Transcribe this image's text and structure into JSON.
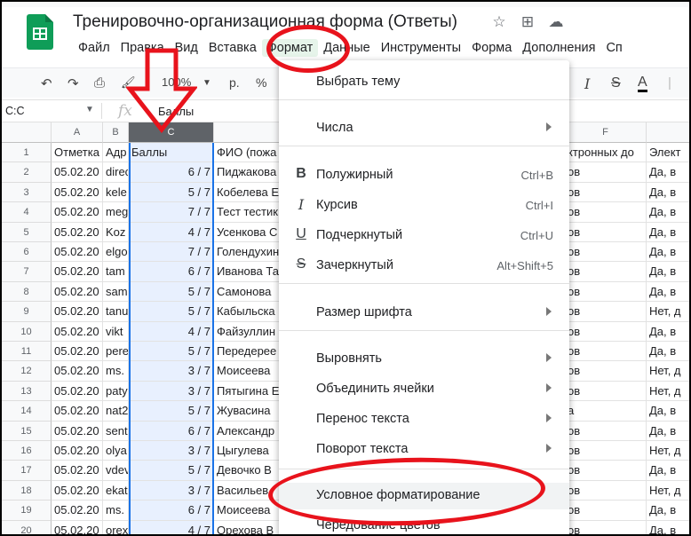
{
  "window": {
    "doc_title": "Тренировочно-организационная форма (Ответы)",
    "title_icons": [
      "star-icon",
      "move-to-folder-icon",
      "cloud-status-icon"
    ]
  },
  "menubar": {
    "items": [
      "Файл",
      "Правка",
      "Вид",
      "Вставка",
      "Формат",
      "Данные",
      "Инструменты",
      "Форма",
      "Дополнения",
      "Сп"
    ],
    "active": "Формат"
  },
  "toolbar": {
    "undo": "↶",
    "redo": "↷",
    "print": "⎙",
    "paint_format": "🖌",
    "zoom": "100%",
    "currency": "р.",
    "percent": "%",
    "italic": "I",
    "strikethrough": "S",
    "text_color": "A"
  },
  "formula_bar": {
    "name_box": "C:C",
    "fx": "fx",
    "value": "Баллы"
  },
  "columns": [
    "A",
    "B",
    "C",
    "",
    "F",
    ""
  ],
  "rows": [
    {
      "n": "1",
      "a": "Отметка",
      "b": "Адр",
      "c": "Баллы",
      "d": "ФИО (пожа",
      "f": "ктронных до",
      "g": "Элект"
    },
    {
      "n": "2",
      "a": "05.02.20",
      "b": "direc",
      "c": "6 / 7",
      "d": "Пиджакова",
      "f": "ов",
      "g": "Да, в"
    },
    {
      "n": "3",
      "a": "05.02.20",
      "b": "kele",
      "c": "5 / 7",
      "d": "Кобелева Е",
      "f": "ов",
      "g": "Да, в"
    },
    {
      "n": "4",
      "a": "05.02.20",
      "b": "meg",
      "c": "7 / 7",
      "d": "Тест тестик",
      "f": "ов",
      "g": "Да, в"
    },
    {
      "n": "5",
      "a": "05.02.20",
      "b": "Koz",
      "c": "4 / 7",
      "d": "Усенкова С",
      "f": "ов",
      "g": "Да, в"
    },
    {
      "n": "6",
      "a": "05.02.20",
      "b": "elgo",
      "c": "7 / 7",
      "d": "Голендухин",
      "f": "ов",
      "g": "Да, в"
    },
    {
      "n": "7",
      "a": "05.02.20",
      "b": "tam",
      "c": "6 / 7",
      "d": "Иванова Та",
      "f": "ов",
      "g": "Да, в"
    },
    {
      "n": "8",
      "a": "05.02.20",
      "b": "sam",
      "c": "5 / 7",
      "d": "Самонова",
      "f": "ов",
      "g": "Да, в"
    },
    {
      "n": "9",
      "a": "05.02.20",
      "b": "tanu",
      "c": "5 / 7",
      "d": "Кабыльска",
      "f": "ов",
      "g": "Нет, д"
    },
    {
      "n": "10",
      "a": "05.02.20",
      "b": "vikt",
      "c": "4 / 7",
      "d": "Файзуллин",
      "f": "ов",
      "g": "Да, в"
    },
    {
      "n": "11",
      "a": "05.02.20",
      "b": "pere",
      "c": "5 / 7",
      "d": "Передерее",
      "f": "ов",
      "g": "Да, в"
    },
    {
      "n": "12",
      "a": "05.02.20",
      "b": "ms.",
      "c": "3 / 7",
      "d": "Моисеева",
      "f": "ов",
      "g": "Нет, д"
    },
    {
      "n": "13",
      "a": "05.02.20",
      "b": "paty",
      "c": "3 / 7",
      "d": "Пятыгина Е",
      "f": "ов",
      "g": "Нет, д"
    },
    {
      "n": "14",
      "a": "05.02.20",
      "b": "nat2",
      "c": "5 / 7",
      "d": "Жувасина",
      "f": "а",
      "g": "Да, в"
    },
    {
      "n": "15",
      "a": "05.02.20",
      "b": "sent",
      "c": "6 / 7",
      "d": "Александр",
      "f": "ов",
      "g": "Да, в"
    },
    {
      "n": "16",
      "a": "05.02.20",
      "b": "olya",
      "c": "3 / 7",
      "d": "Цыгулева",
      "f": "ов",
      "g": "Нет, д"
    },
    {
      "n": "17",
      "a": "05.02.20",
      "b": "vdev",
      "c": "5 / 7",
      "d": "Девочко В",
      "f": "ов",
      "g": "Да, в"
    },
    {
      "n": "18",
      "a": "05.02.20",
      "b": "ekat",
      "c": "3 / 7",
      "d": "Васильев",
      "f": "ов",
      "g": "Нет, д"
    },
    {
      "n": "19",
      "a": "05.02.20",
      "b": "ms.",
      "c": "6 / 7",
      "d": "Моисеева",
      "f": "ов",
      "g": "Да, в"
    },
    {
      "n": "20",
      "a": "05.02.20",
      "b": "orex",
      "c": "4 / 7",
      "d": "Орехова В",
      "f": "ов",
      "g": "Да, в"
    }
  ],
  "format_menu": {
    "items": [
      {
        "label": "Выбрать тему",
        "icon": "",
        "shortcut": "",
        "submenu": false
      },
      {
        "label": "Числа",
        "icon": "",
        "shortcut": "",
        "submenu": true
      },
      {
        "label": "Полужирный",
        "icon": "B",
        "icon_name": "bold-icon",
        "shortcut": "Ctrl+B",
        "submenu": false
      },
      {
        "label": "Курсив",
        "icon": "I",
        "icon_name": "italic-icon",
        "shortcut": "Ctrl+I",
        "submenu": false
      },
      {
        "label": "Подчеркнутый",
        "icon": "U",
        "icon_name": "underline-icon",
        "shortcut": "Ctrl+U",
        "submenu": false
      },
      {
        "label": "Зачеркнутый",
        "icon": "S",
        "icon_name": "strikethrough-icon",
        "shortcut": "Alt+Shift+5",
        "submenu": false
      },
      {
        "label": "Размер шрифта",
        "icon": "",
        "shortcut": "",
        "submenu": true
      },
      {
        "label": "Выровнять",
        "icon": "",
        "shortcut": "",
        "submenu": true
      },
      {
        "label": "Объединить ячейки",
        "icon": "",
        "shortcut": "",
        "submenu": true
      },
      {
        "label": "Перенос текста",
        "icon": "",
        "shortcut": "",
        "submenu": true
      },
      {
        "label": "Поворот текста",
        "icon": "",
        "shortcut": "",
        "submenu": true
      },
      {
        "label": "Условное форматирование",
        "icon": "",
        "shortcut": "",
        "submenu": false
      },
      {
        "label": "Чередование цветов",
        "icon": "",
        "shortcut": "",
        "submenu": false
      }
    ]
  },
  "colors": {
    "accent": "#1a73e8",
    "annotation": "#e8131c",
    "brand": "#0f9d58",
    "menu_active": "#e6f4ea"
  }
}
